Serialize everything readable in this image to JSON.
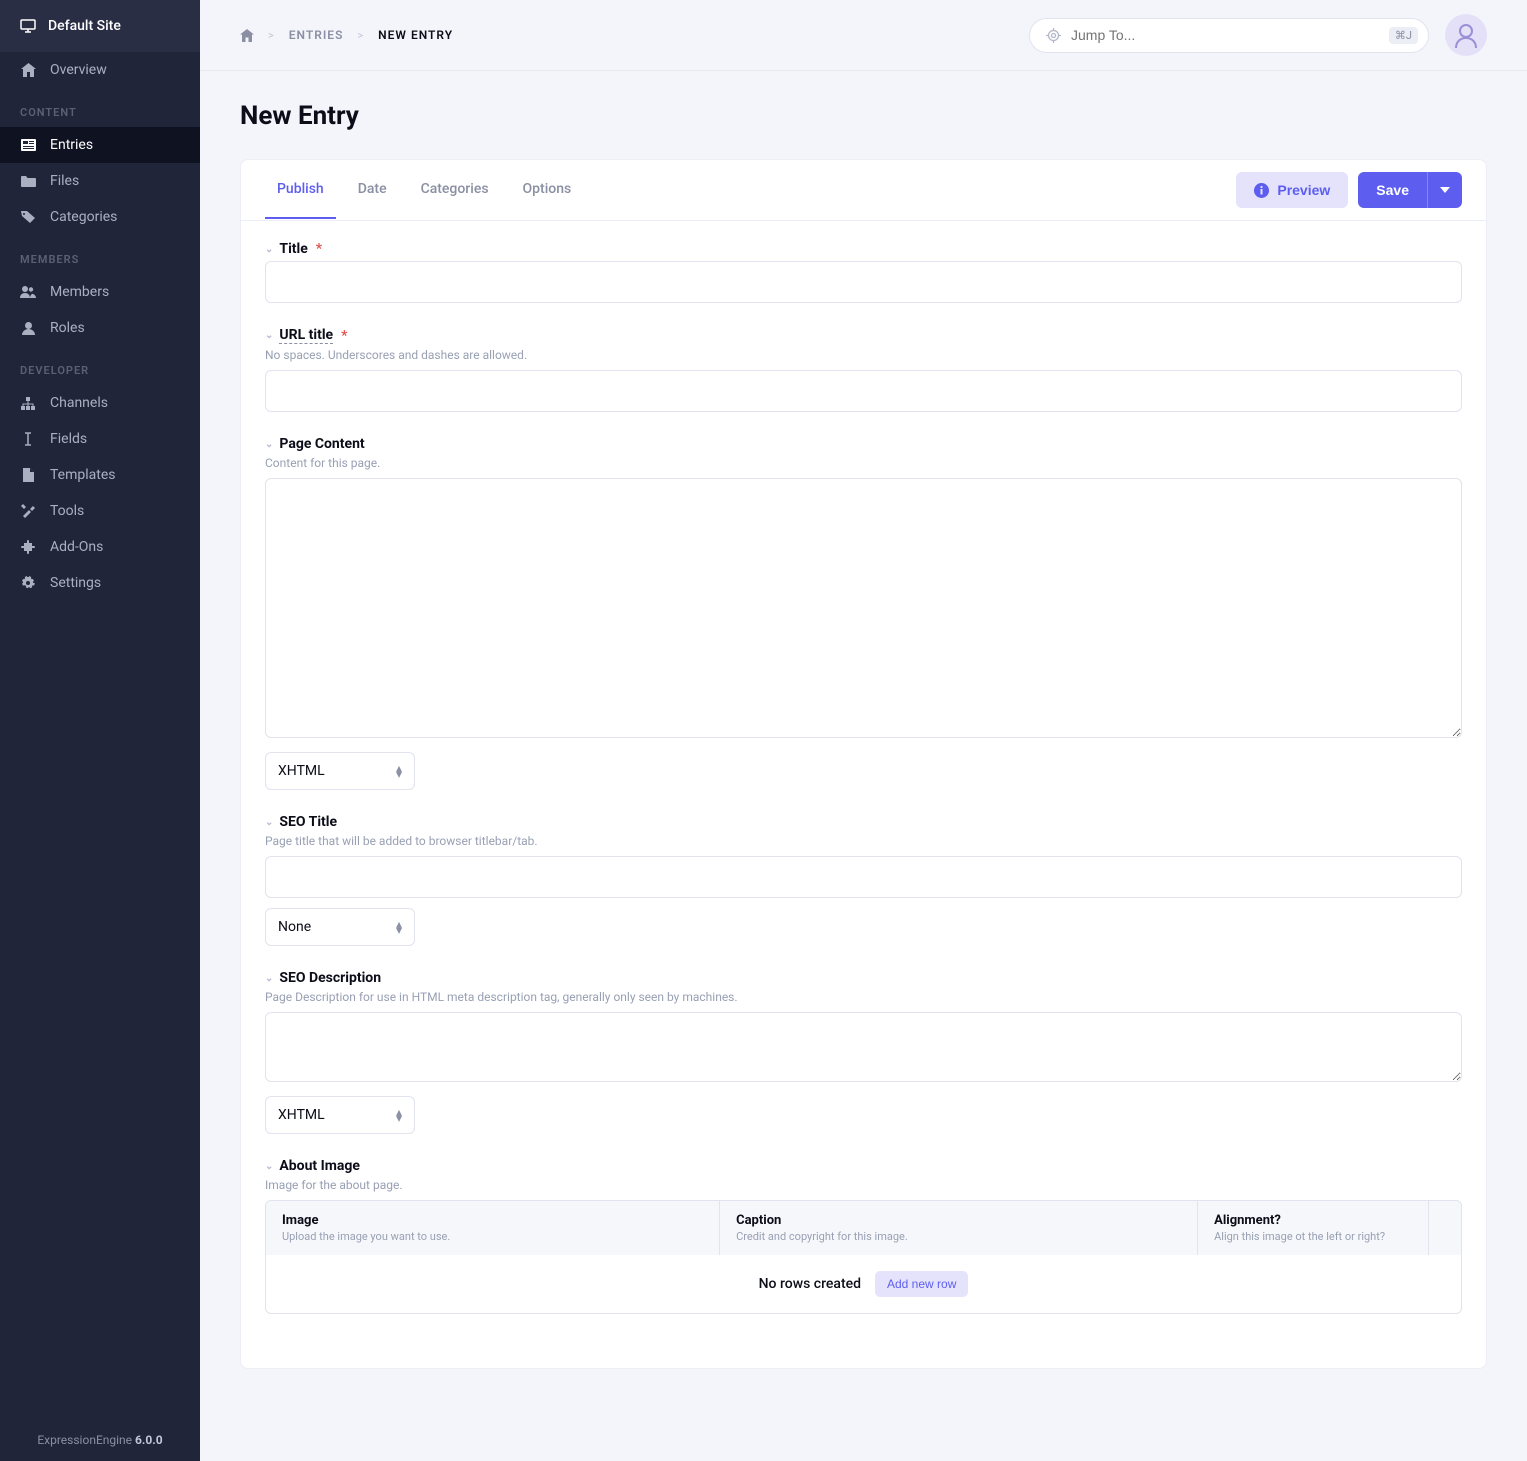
{
  "site_name": "Default Site",
  "footer": {
    "product": "ExpressionEngine",
    "version": "6.0.0"
  },
  "sidebar": {
    "overview": "Overview",
    "sections": {
      "content": {
        "label": "CONTENT",
        "items": [
          {
            "label": "Entries",
            "active": true
          },
          {
            "label": "Files"
          },
          {
            "label": "Categories"
          }
        ]
      },
      "members": {
        "label": "MEMBERS",
        "items": [
          {
            "label": "Members"
          },
          {
            "label": "Roles"
          }
        ]
      },
      "developer": {
        "label": "DEVELOPER",
        "items": [
          {
            "label": "Channels"
          },
          {
            "label": "Fields"
          },
          {
            "label": "Templates"
          },
          {
            "label": "Tools"
          },
          {
            "label": "Add-Ons"
          },
          {
            "label": "Settings"
          }
        ]
      }
    }
  },
  "breadcrumb": {
    "entries": "ENTRIES",
    "current": "NEW ENTRY"
  },
  "jump": {
    "placeholder": "Jump To...",
    "shortcut": "⌘J"
  },
  "page_title": "New Entry",
  "tabs": {
    "publish": "Publish",
    "date": "Date",
    "categories": "Categories",
    "options": "Options"
  },
  "actions": {
    "preview": "Preview",
    "save": "Save"
  },
  "fields": {
    "title": {
      "label": "Title",
      "value": ""
    },
    "url_title": {
      "label": "URL title",
      "help": "No spaces. Underscores and dashes are allowed.",
      "value": ""
    },
    "page_content": {
      "label": "Page Content",
      "help": "Content for this page.",
      "value": "",
      "format": "XHTML"
    },
    "seo_title": {
      "label": "SEO Title",
      "help": "Page title that will be added to browser titlebar/tab.",
      "value": "",
      "format": "None"
    },
    "seo_description": {
      "label": "SEO Description",
      "help": "Page Description for use in HTML meta description tag, generally only seen by machines.",
      "value": "",
      "format": "XHTML"
    },
    "about_image": {
      "label": "About Image",
      "help": "Image for the about page.",
      "columns": {
        "image": {
          "title": "Image",
          "help": "Upload the image you want to use."
        },
        "caption": {
          "title": "Caption",
          "help": "Credit and copyright for this image."
        },
        "alignment": {
          "title": "Alignment?",
          "help": "Align this image ot the left or right?"
        }
      },
      "empty": "No rows created",
      "add": "Add new row"
    }
  }
}
